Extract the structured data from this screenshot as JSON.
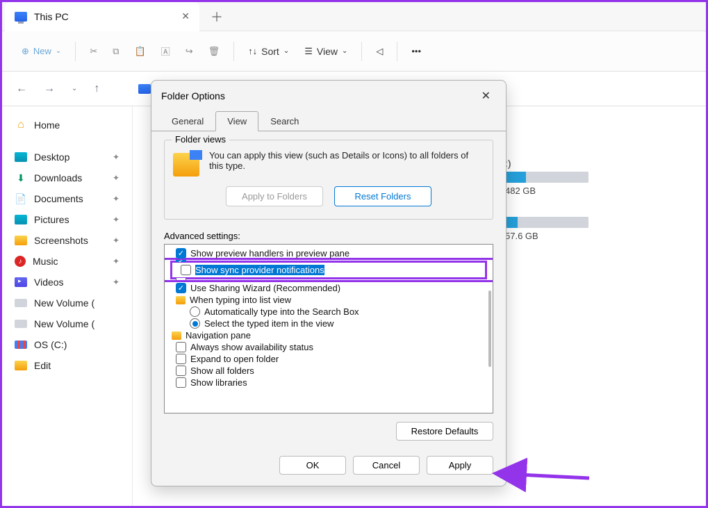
{
  "tab": {
    "title": "This PC"
  },
  "toolbar": {
    "new": "New",
    "sort": "Sort",
    "view": "View"
  },
  "sidebar": {
    "items": [
      {
        "label": "Home"
      },
      {
        "label": "Desktop"
      },
      {
        "label": "Downloads"
      },
      {
        "label": "Documents"
      },
      {
        "label": "Pictures"
      },
      {
        "label": "Screenshots"
      },
      {
        "label": "Music"
      },
      {
        "label": "Videos"
      },
      {
        "label": "New Volume ("
      },
      {
        "label": "New Volume ("
      },
      {
        "label": "OS (C:)"
      },
      {
        "label": "Edit"
      }
    ]
  },
  "storage": [
    {
      "label": ":)",
      "free": "482 GB",
      "pct": 25
    },
    {
      "label": "",
      "free": "57.6 GB",
      "pct": 15
    }
  ],
  "dialog": {
    "title": "Folder Options",
    "tabs": {
      "general": "General",
      "view": "View",
      "search": "Search"
    },
    "folderViews": {
      "legend": "Folder views",
      "desc": "You can apply this view (such as Details or Icons) to all folders of this type.",
      "apply": "Apply to Folders",
      "reset": "Reset Folders"
    },
    "advanced": {
      "label": "Advanced settings:",
      "items": [
        "Show preview handlers in preview pane",
        "Show sync provider notifications",
        "Use Sharing Wizard (Recommended)",
        "When typing into list view",
        "Automatically type into the Search Box",
        "Select the typed item in the view",
        "Navigation pane",
        "Always show availability status",
        "Expand to open folder",
        "Show all folders",
        "Show libraries"
      ],
      "restore": "Restore Defaults"
    },
    "buttons": {
      "ok": "OK",
      "cancel": "Cancel",
      "apply": "Apply"
    }
  }
}
